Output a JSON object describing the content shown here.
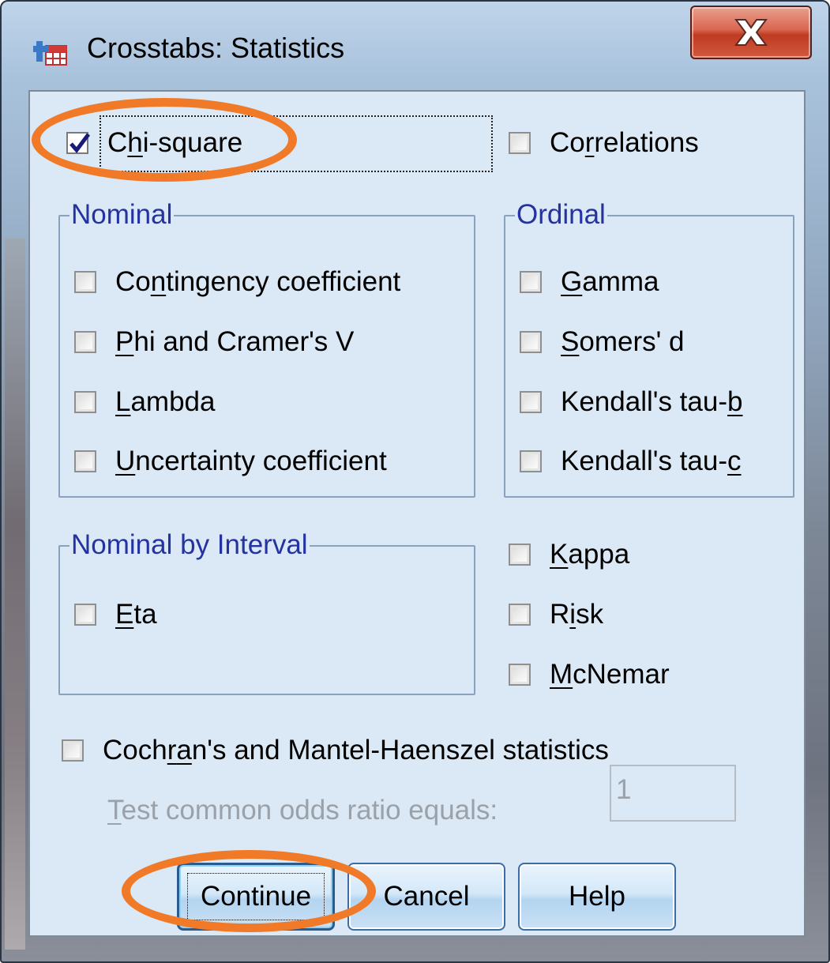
{
  "window": {
    "title": "Crosstabs: Statistics",
    "close_glyph": "X"
  },
  "top": {
    "chi_square": {
      "label": "Chi-square",
      "checked": true
    },
    "correlations": {
      "label": "Correlations",
      "checked": false
    }
  },
  "nominal": {
    "title": "Nominal",
    "items": [
      {
        "label": "Contingency coefficient",
        "checked": false
      },
      {
        "label": "Phi and Cramer's V",
        "checked": false
      },
      {
        "label": "Lambda",
        "checked": false
      },
      {
        "label": "Uncertainty coefficient",
        "checked": false
      }
    ]
  },
  "ordinal": {
    "title": "Ordinal",
    "items": [
      {
        "label": "Gamma",
        "checked": false
      },
      {
        "label": "Somers' d",
        "checked": false
      },
      {
        "label": "Kendall's tau-b",
        "checked": false
      },
      {
        "label": "Kendall's tau-c",
        "checked": false
      }
    ]
  },
  "nominal_by_interval": {
    "title": "Nominal by Interval",
    "items": [
      {
        "label": "Eta",
        "checked": false
      }
    ]
  },
  "other": [
    {
      "label": "Kappa",
      "checked": false
    },
    {
      "label": "Risk",
      "checked": false
    },
    {
      "label": "McNemar",
      "checked": false
    }
  ],
  "cmh": {
    "label": "Cochran's and Mantel-Haenszel statistics",
    "checked": false,
    "odds_label": "Test common odds ratio equals:",
    "odds_value": "1"
  },
  "buttons": {
    "continue": "Continue",
    "cancel": "Cancel",
    "help": "Help"
  },
  "colors": {
    "highlight": "#f07a28",
    "group_title": "#2433a0",
    "client_bg": "#dbe8f5"
  }
}
